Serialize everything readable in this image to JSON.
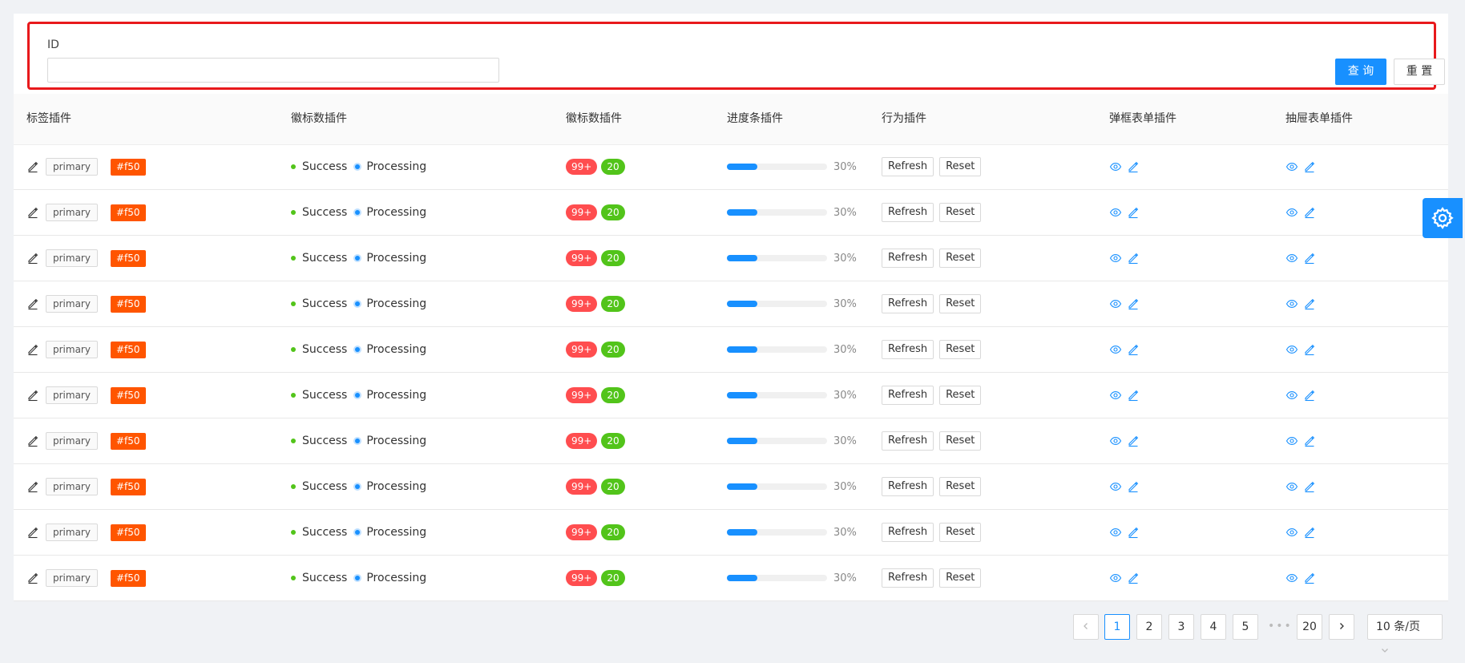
{
  "search": {
    "id_label": "ID",
    "id_value": "",
    "query_label": "查 询",
    "reset_label": "重 置"
  },
  "columns": [
    "标签插件",
    "徽标数插件",
    "徽标数插件",
    "进度条插件",
    "行为插件",
    "弹框表单插件",
    "抽屉表单插件"
  ],
  "rows": [
    {
      "tag1": "primary",
      "tag2": "#f50",
      "status1": "Success",
      "status2": "Processing",
      "badge1": "99+",
      "badge2": "20",
      "progress": 30,
      "progress_text": "30%",
      "btn1": "Refresh",
      "btn2": "Reset"
    },
    {
      "tag1": "primary",
      "tag2": "#f50",
      "status1": "Success",
      "status2": "Processing",
      "badge1": "99+",
      "badge2": "20",
      "progress": 30,
      "progress_text": "30%",
      "btn1": "Refresh",
      "btn2": "Reset"
    },
    {
      "tag1": "primary",
      "tag2": "#f50",
      "status1": "Success",
      "status2": "Processing",
      "badge1": "99+",
      "badge2": "20",
      "progress": 30,
      "progress_text": "30%",
      "btn1": "Refresh",
      "btn2": "Reset"
    },
    {
      "tag1": "primary",
      "tag2": "#f50",
      "status1": "Success",
      "status2": "Processing",
      "badge1": "99+",
      "badge2": "20",
      "progress": 30,
      "progress_text": "30%",
      "btn1": "Refresh",
      "btn2": "Reset"
    },
    {
      "tag1": "primary",
      "tag2": "#f50",
      "status1": "Success",
      "status2": "Processing",
      "badge1": "99+",
      "badge2": "20",
      "progress": 30,
      "progress_text": "30%",
      "btn1": "Refresh",
      "btn2": "Reset"
    },
    {
      "tag1": "primary",
      "tag2": "#f50",
      "status1": "Success",
      "status2": "Processing",
      "badge1": "99+",
      "badge2": "20",
      "progress": 30,
      "progress_text": "30%",
      "btn1": "Refresh",
      "btn2": "Reset"
    },
    {
      "tag1": "primary",
      "tag2": "#f50",
      "status1": "Success",
      "status2": "Processing",
      "badge1": "99+",
      "badge2": "20",
      "progress": 30,
      "progress_text": "30%",
      "btn1": "Refresh",
      "btn2": "Reset"
    },
    {
      "tag1": "primary",
      "tag2": "#f50",
      "status1": "Success",
      "status2": "Processing",
      "badge1": "99+",
      "badge2": "20",
      "progress": 30,
      "progress_text": "30%",
      "btn1": "Refresh",
      "btn2": "Reset"
    },
    {
      "tag1": "primary",
      "tag2": "#f50",
      "status1": "Success",
      "status2": "Processing",
      "badge1": "99+",
      "badge2": "20",
      "progress": 30,
      "progress_text": "30%",
      "btn1": "Refresh",
      "btn2": "Reset"
    },
    {
      "tag1": "primary",
      "tag2": "#f50",
      "status1": "Success",
      "status2": "Processing",
      "badge1": "99+",
      "badge2": "20",
      "progress": 30,
      "progress_text": "30%",
      "btn1": "Refresh",
      "btn2": "Reset"
    }
  ],
  "pagination": {
    "prev_icon": "chevron-left-icon",
    "pages": [
      "1",
      "2",
      "3",
      "4",
      "5"
    ],
    "current": "1",
    "ellipsis": "•••",
    "last": "20",
    "next_icon": "chevron-right-icon",
    "page_size": "10 条/页"
  },
  "settings_icon": "gear-icon",
  "colors": {
    "primary": "#1890ff",
    "tag_orange": "#ff5500",
    "badge_red": "#ff4d4f",
    "badge_green": "#52c41a",
    "highlight": "#e8191c"
  }
}
